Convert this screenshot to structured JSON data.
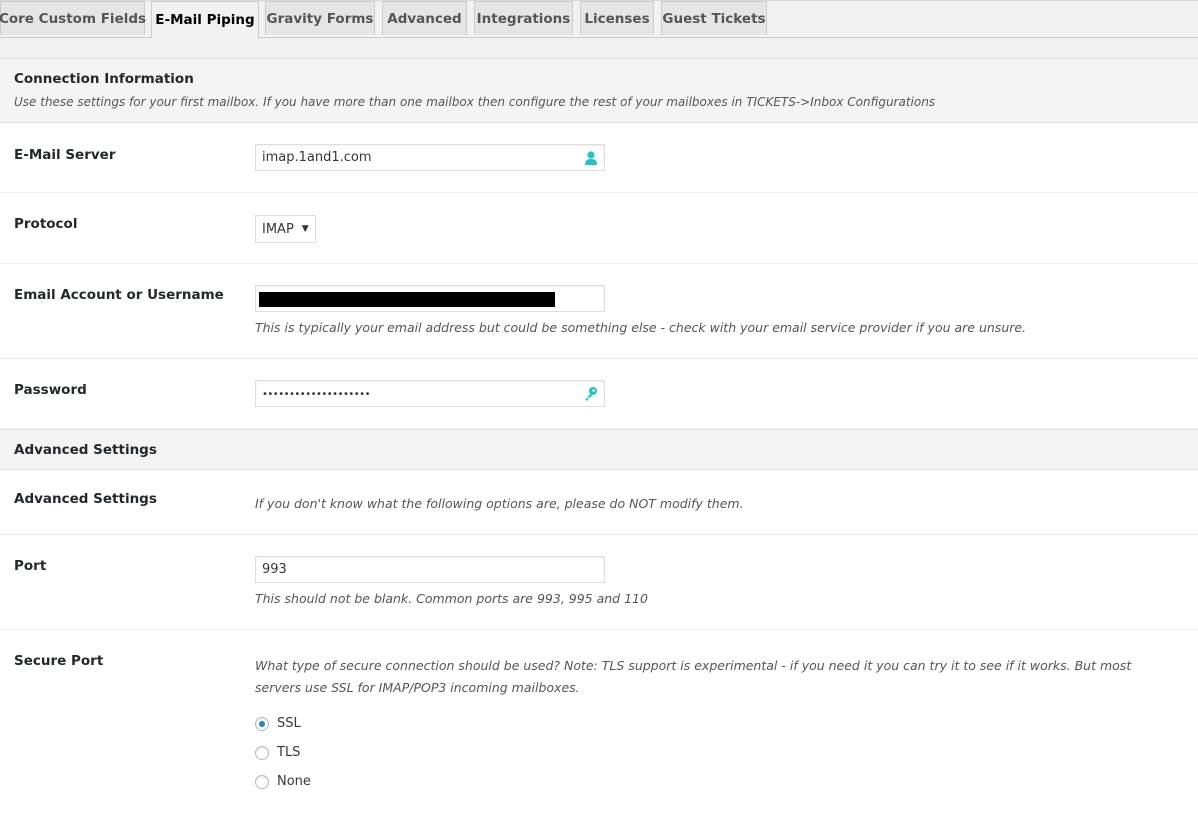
{
  "tabs": [
    {
      "label": "Core Custom Fields",
      "active": false
    },
    {
      "label": "E-Mail Piping",
      "active": true
    },
    {
      "label": "Gravity Forms",
      "active": false
    },
    {
      "label": "Advanced",
      "active": false
    },
    {
      "label": "Integrations",
      "active": false
    },
    {
      "label": "Licenses",
      "active": false
    },
    {
      "label": "Guest Tickets",
      "active": false
    }
  ],
  "connection": {
    "title": "Connection Information",
    "description": "Use these settings for your first mailbox. If you have more than one mailbox then configure the rest of your mailboxes in TICKETS->Inbox Configurations"
  },
  "fields": {
    "email_server": {
      "label": "E-Mail Server",
      "value": "imap.1and1.com",
      "icon": "user-icon"
    },
    "protocol": {
      "label": "Protocol",
      "value": "IMAP"
    },
    "username": {
      "label": "Email Account or Username",
      "value": "[redacted]",
      "help": "This is typically your email address but could be something else - check with your email service provider if you are unsure."
    },
    "password": {
      "label": "Password",
      "value": "••••••••••••••••••••",
      "icon": "key-icon"
    }
  },
  "advanced": {
    "section_title": "Advanced Settings",
    "row_label": "Advanced Settings",
    "row_help": "If you don't know what the following options are, please do NOT modify them.",
    "port": {
      "label": "Port",
      "value": "993",
      "help": "This should not be blank. Common ports are 993, 995 and 110"
    },
    "secure_port": {
      "label": "Secure Port",
      "help": "What type of secure connection should be used? Note: TLS support is experimental - if you need it you can try it to see if it works. But most servers use SSL for IMAP/POP3 incoming mailboxes.",
      "options": [
        {
          "label": "SSL",
          "checked": true
        },
        {
          "label": "TLS",
          "checked": false
        },
        {
          "label": "None",
          "checked": false
        }
      ]
    }
  },
  "colors": {
    "accent_icon": "#1fc5c5",
    "radio_checked": "#1e8cbe"
  }
}
